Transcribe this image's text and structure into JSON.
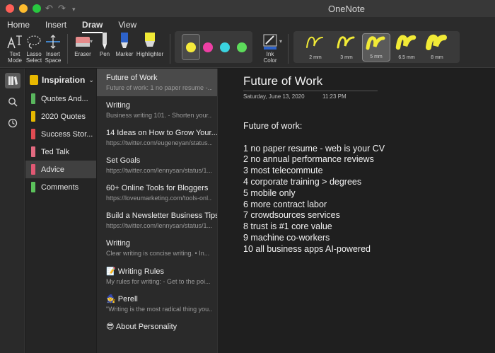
{
  "window": {
    "title": "OneNote",
    "controls": [
      "close",
      "minimize",
      "zoom"
    ],
    "colors": {
      "close": "#ff5f57",
      "minimize": "#febc2e",
      "zoom": "#28c840"
    }
  },
  "ribbon": {
    "tabs": [
      {
        "label": "Home",
        "active": false
      },
      {
        "label": "Insert",
        "active": false
      },
      {
        "label": "Draw",
        "active": true
      },
      {
        "label": "View",
        "active": false
      }
    ],
    "tools": {
      "text_mode": [
        "Text",
        "Mode"
      ],
      "lasso_select": [
        "Lasso",
        "Select"
      ],
      "insert_space": [
        "Insert",
        "Space"
      ],
      "eraser": "Eraser",
      "pen": "Pen",
      "marker": "Marker",
      "highlighter": "Highlighter",
      "ink_color": [
        "Ink",
        "Color"
      ]
    },
    "pen_colors": [
      "#f5ea3b",
      "#ee3fa4",
      "#3ad3e0",
      "#5ddc5b"
    ],
    "selected_pen_index": 0,
    "thicknesses": [
      "2 mm",
      "3 mm",
      "5 mm",
      "6.5 mm",
      "8 mm"
    ],
    "selected_thickness_index": 2,
    "stroke_color": "#f1ea36"
  },
  "notebook": {
    "name": "Inspiration",
    "sections": [
      {
        "label": "Quotes And...",
        "color": "#59b65d",
        "selected": false
      },
      {
        "label": "2020 Quotes",
        "color": "#e6b800",
        "selected": false
      },
      {
        "label": "Success Stor...",
        "color": "#e04b52",
        "selected": false
      },
      {
        "label": "Ted Talk",
        "color": "#e36a80",
        "selected": false
      },
      {
        "label": "Advice",
        "color": "#e15873",
        "selected": true
      },
      {
        "label": "Comments",
        "color": "#5bc25b",
        "selected": false
      }
    ]
  },
  "pages": [
    {
      "title": "Future of Work",
      "preview": "Future of work:  1 no paper resume -...",
      "selected": true
    },
    {
      "title": "Writing",
      "preview": "Business writing 101.  - Shorten your...",
      "selected": false
    },
    {
      "title": "14 Ideas on How to Grow Your...",
      "preview": "https://twitter.com/eugeneyan/status...",
      "selected": false
    },
    {
      "title": "Set Goals",
      "preview": "https://twitter.com/lennysan/status/1...",
      "selected": false
    },
    {
      "title": "60+ Online Tools for Bloggers",
      "preview": "https://loveumarketing.com/tools-onl...",
      "selected": false
    },
    {
      "title": "Build a Newsletter Business Tips",
      "preview": "https://twitter.com/lennysan/status/1...",
      "selected": false
    },
    {
      "title": "Writing",
      "preview": "Clear writing is concise writing.  • In...",
      "selected": false
    },
    {
      "title": "📝 Writing Rules",
      "preview": "My rules for writing:  - Get to the poi...",
      "selected": false
    },
    {
      "title": "🧙 Perell",
      "preview": "\"Writing is the most radical thing you...",
      "selected": false
    },
    {
      "title": "😎 About Personality",
      "preview": "",
      "selected": false
    }
  ],
  "note": {
    "title": "Future of Work",
    "date": "Saturday, June 13, 2020",
    "time": "11:23 PM",
    "heading": "Future of work:",
    "lines": [
      "1 no paper resume - web is your CV",
      "2 no annual performance reviews",
      "3 most telecommute",
      "4 corporate training > degrees",
      "5 mobile only",
      "6 more contract labor",
      "7 crowdsources services",
      "8 trust is #1 core value",
      "9 machine co-workers",
      "10 all business apps AI-powered"
    ]
  }
}
